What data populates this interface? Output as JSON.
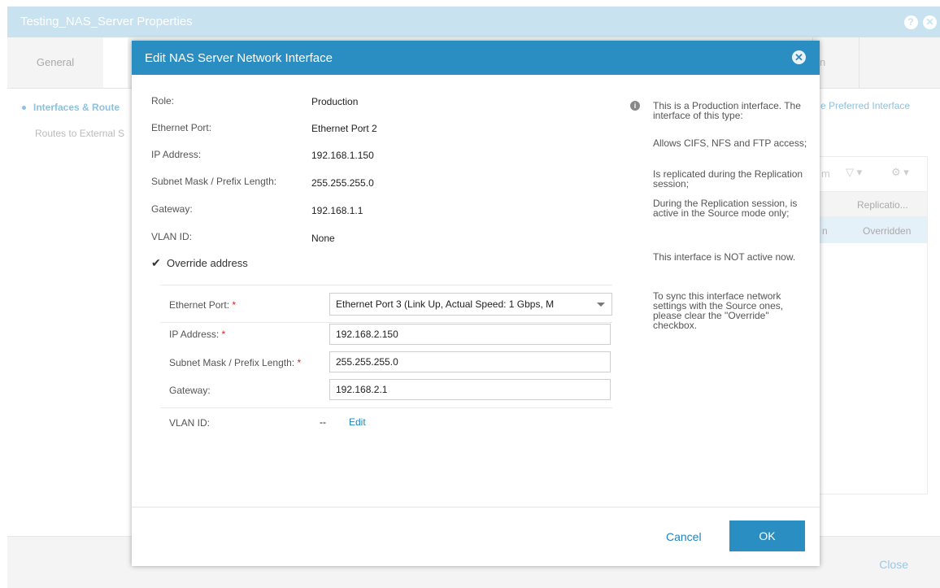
{
  "background": {
    "window_title": "Testing_NAS_Server Properties",
    "tabs": [
      "General"
    ],
    "tab_right_fragment": "n",
    "nav_items": [
      "Interfaces & Route",
      "Routes to External S"
    ],
    "preferred_interface_link": "e Preferred Interface",
    "toolbar_fragment": "m",
    "table_header": "Replicatio...",
    "table_row_left": "n",
    "table_row_value": "Overridden",
    "close_label": "Close"
  },
  "dialog": {
    "title": "Edit NAS Server Network Interface",
    "fields": {
      "role": {
        "label": "Role:",
        "value": "Production"
      },
      "ethernet_port": {
        "label": "Ethernet Port:",
        "value": "Ethernet Port 2"
      },
      "ip_address": {
        "label": "IP Address:",
        "value": "192.168.1.150"
      },
      "subnet_mask": {
        "label": "Subnet Mask / Prefix Length:",
        "value": "255.255.255.0"
      },
      "gateway": {
        "label": "Gateway:",
        "value": "192.168.1.1"
      },
      "vlan_id": {
        "label": "VLAN ID:",
        "value": "None"
      }
    },
    "override_checkbox": {
      "label": "Override address",
      "checked": true
    },
    "override": {
      "ethernet_port_label": "Ethernet Port:",
      "ethernet_port_value": "Ethernet Port 3 (Link Up, Actual Speed: 1 Gbps, M",
      "ip_address_label": "IP Address:",
      "ip_address_value": "192.168.2.150",
      "subnet_mask_label": "Subnet Mask / Prefix Length:",
      "subnet_mask_value": "255.255.255.0",
      "gateway_label": "Gateway:",
      "gateway_value": "192.168.2.1",
      "vlan_id_label": "VLAN ID:",
      "vlan_id_value": "--",
      "edit_label": "Edit",
      "required_mark": "*"
    },
    "info": {
      "p1": "This is a Production interface. The interface of this type:",
      "p2": "Allows CIFS, NFS and FTP access;",
      "p3": "Is replicated during the Replication session;",
      "p4": "During the Replication session, is active in the Source mode only;",
      "p5": "This interface is NOT active now.",
      "p6": "To sync this interface network settings with the Source ones, please clear the \"Override\" checkbox."
    },
    "buttons": {
      "cancel": "Cancel",
      "ok": "OK"
    }
  }
}
